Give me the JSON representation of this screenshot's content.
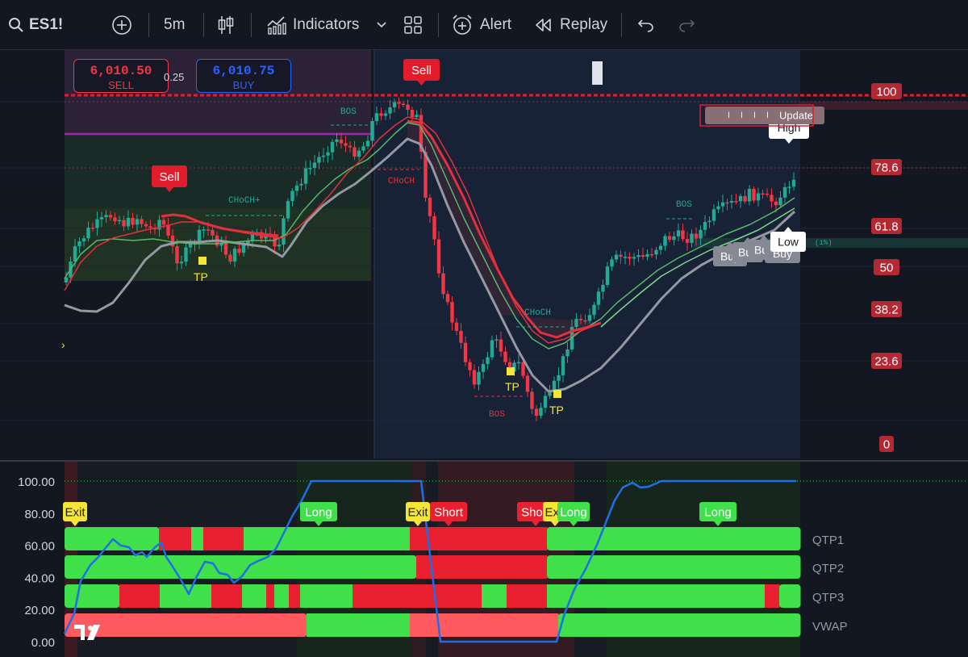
{
  "toolbar": {
    "symbol": "ES1!",
    "interval": "5m",
    "indicators_label": "Indicators",
    "alert_label": "Alert",
    "replay_label": "Replay"
  },
  "trade": {
    "sell_price": "6,010.50",
    "sell_label": "SELL",
    "spread": "0.25",
    "buy_price": "6,010.75",
    "buy_label": "BUY"
  },
  "fib_levels": [
    "100",
    "78.6",
    "61.8",
    "50",
    "38.2",
    "23.6",
    "0"
  ],
  "chart_labels": {
    "signals": [
      {
        "text": "Sell",
        "kind": "sell"
      },
      {
        "text": "Sell",
        "kind": "sell"
      },
      {
        "text": "Buy",
        "kind": "buy"
      },
      {
        "text": "Buy",
        "kind": "buy"
      },
      {
        "text": "Buy",
        "kind": "buy"
      }
    ],
    "structure": [
      "BOS",
      "CHoCH+",
      "CHoCH",
      "BOS",
      "CHoCH",
      "BOS"
    ],
    "take_profit": "TP",
    "high": "High",
    "low": "Low",
    "pct": "(1%)",
    "update": "Update"
  },
  "oscillator": {
    "y_ticks": [
      "100.00",
      "80.00",
      "60.00",
      "40.00",
      "20.00",
      "0.00"
    ],
    "rows": [
      "QTP1",
      "QTP2",
      "QTP3",
      "VWAP"
    ],
    "signals": [
      {
        "text": "Exit",
        "kind": "exit"
      },
      {
        "text": "Long",
        "kind": "long"
      },
      {
        "text": "Exit",
        "kind": "exit"
      },
      {
        "text": "Short",
        "kind": "short"
      },
      {
        "text": "Short",
        "kind": "short"
      },
      {
        "text": "Exit",
        "kind": "exit"
      },
      {
        "text": "Long",
        "kind": "long"
      },
      {
        "text": "Long",
        "kind": "long"
      }
    ]
  },
  "colors": {
    "bull": "#22ab94",
    "bear": "#f23645",
    "long": "#3fe04a",
    "short": "#e8202f",
    "exit": "#f5e636",
    "line": "#1e6fe6",
    "fib": "#b22833"
  }
}
